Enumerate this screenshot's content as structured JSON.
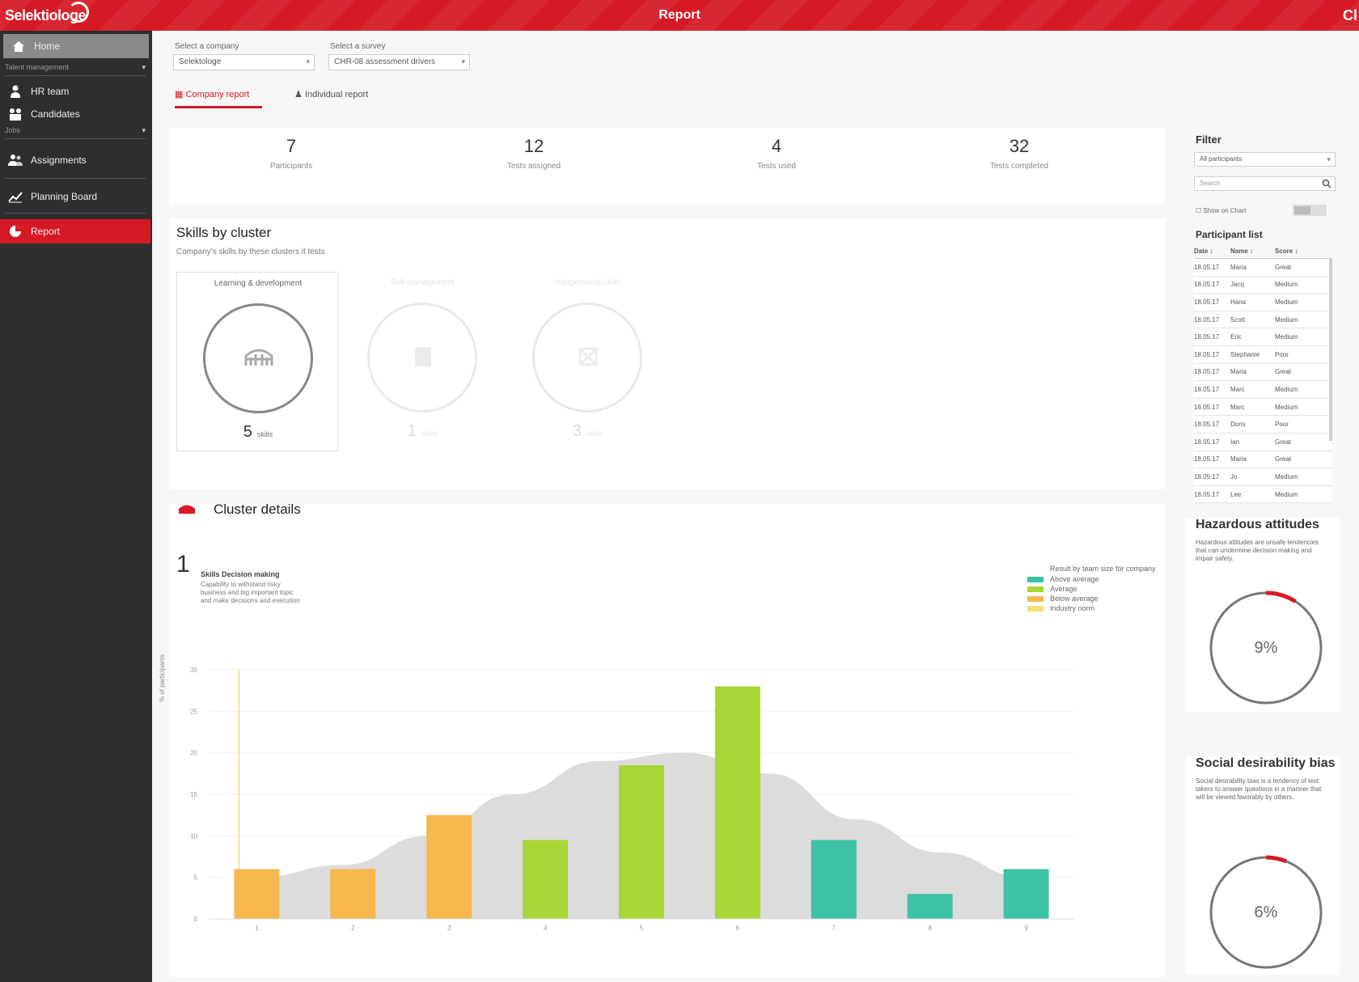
{
  "topbar": {
    "logo": "Selektiologe",
    "title": "Report",
    "right": "Cl"
  },
  "sidebar": {
    "home": "Home",
    "section1": "Talent management",
    "items1": [
      "HR team",
      "Candidates"
    ],
    "section2": "Jobs",
    "items2": [
      "Assignments",
      "Planning Board"
    ],
    "report": "Report"
  },
  "filters": {
    "company_label": "Select a company",
    "company_value": "Selektologe",
    "survey_label": "Select a survey",
    "survey_value": "CHR-08 assessment drivers"
  },
  "tabs": [
    "Company report",
    "Individual report"
  ],
  "stats": [
    {
      "value": "7",
      "label": "Participants"
    },
    {
      "value": "12",
      "label": "Tests assigned"
    },
    {
      "value": "4",
      "label": "Tests used"
    },
    {
      "value": "32",
      "label": "Tests completed"
    }
  ],
  "skills": {
    "title": "Skills by cluster",
    "subtitle": "Company's skills by these clusters it tests",
    "clusters": [
      {
        "name": "Learning & development",
        "count": "5",
        "unit": "skills",
        "icon": "bridge-icon"
      },
      {
        "name": "Self-management",
        "count": "1",
        "unit": "skills",
        "icon": "building-icon"
      },
      {
        "name": "Interpersonal skills",
        "count": "3",
        "unit": "skills",
        "icon": "puzzle-icon"
      }
    ]
  },
  "detail": {
    "title": "Cluster details",
    "index": "1",
    "skill_name": "Skills Decision making",
    "skill_desc": "Capability to withstand risky business and big important topic and make decisions and execution",
    "legend_title": "Result by team size for company",
    "legend": [
      {
        "label": "Above average",
        "color": "#3fc1a5"
      },
      {
        "label": "Average",
        "color": "#a8d636"
      },
      {
        "label": "Below average",
        "color": "#f6b84e"
      },
      {
        "label": "Industry norm",
        "color": "#f3e07a"
      }
    ],
    "ylabel": "% of participants"
  },
  "chart_data": {
    "type": "bar",
    "categories": [
      "1",
      "2",
      "3",
      "4",
      "5",
      "6",
      "7",
      "8",
      "9"
    ],
    "values": [
      6,
      6,
      12.5,
      9.5,
      18.5,
      28,
      9.5,
      3,
      6
    ],
    "colors": [
      "#f6b84e",
      "#f6b84e",
      "#f6b84e",
      "#a8d636",
      "#a8d636",
      "#a8d636",
      "#3fc1a5",
      "#3fc1a5",
      "#3fc1a5"
    ],
    "curve": [
      5,
      6.5,
      10,
      15,
      19,
      20,
      17.5,
      12,
      8,
      5
    ],
    "yticks": [
      "0",
      "5",
      "10",
      "15",
      "20",
      "25",
      "30"
    ],
    "ylim": [
      0,
      30
    ],
    "grid": true
  },
  "right": {
    "filter_label": "Filter",
    "filter_select": "All participants",
    "search_placeholder": "Search",
    "toggle_label": "Show on Chart",
    "list_title": "Participant list",
    "columns": [
      "Date ↕",
      "Name ↕",
      "Score ↕"
    ],
    "rows": [
      [
        "18.05.17",
        "Maria",
        "Great"
      ],
      [
        "18.05.17",
        "Jacq",
        "Medium"
      ],
      [
        "18.05.17",
        "Hana",
        "Medium"
      ],
      [
        "18.05.17",
        "Scott",
        "Medium"
      ],
      [
        "18.05.17",
        "Eric",
        "Medium"
      ],
      [
        "18.05.17",
        "Stephanie",
        "Poor"
      ],
      [
        "18.05.17",
        "Maria",
        "Great"
      ],
      [
        "18.05.17",
        "Marc",
        "Medium"
      ],
      [
        "18.05.17",
        "Marc",
        "Medium"
      ],
      [
        "18.05.17",
        "Doris",
        "Poor"
      ],
      [
        "18.05.17",
        "Ian",
        "Great"
      ],
      [
        "18.05.17",
        "Maria",
        "Great"
      ],
      [
        "18.05.17",
        "Jo",
        "Medium"
      ],
      [
        "18.05.17",
        "Lee",
        "Medium"
      ]
    ],
    "hazard_title": "Hazardous attitudes",
    "hazard_desc": "Hazardous attitudes are unsafe tendencies that can undermine decision making and impair safety.",
    "hazard_value": "9%",
    "hazard_fraction": 0.09,
    "social_title": "Social desirability bias",
    "social_desc": "Social desirability bias is a tendency of test takers to answer questions in a manner that will be viewed favorably by others.",
    "social_value": "6%",
    "social_fraction": 0.06
  }
}
